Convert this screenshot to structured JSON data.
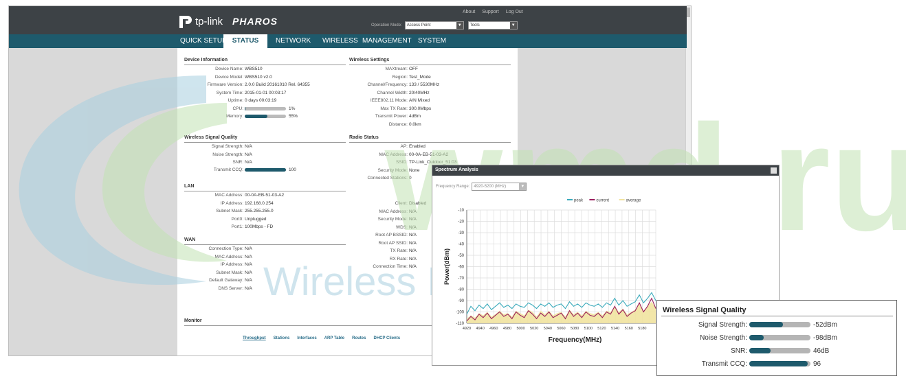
{
  "header": {
    "brand": "tp-link",
    "product": "PHAROS",
    "links": [
      "About",
      "Support",
      "Log Out"
    ],
    "operation_mode_label": "Operation Mode:",
    "operation_mode_value": "Access Point",
    "tools_value": "Tools"
  },
  "nav": {
    "items": [
      {
        "label": "QUICK SETUP",
        "active": false
      },
      {
        "label": "STATUS",
        "active": true
      },
      {
        "label": "NETWORK",
        "active": false
      },
      {
        "label": "WIRELESS",
        "active": false
      },
      {
        "label": "MANAGEMENT",
        "active": false
      },
      {
        "label": "SYSTEM",
        "active": false
      }
    ]
  },
  "device_info": {
    "title": "Device Information",
    "rows": [
      {
        "label": "Device Name:",
        "value": "WBS510"
      },
      {
        "label": "Device Model:",
        "value": "WBS510 v2.0"
      },
      {
        "label": "Firmware Version:",
        "value": "2.0.0 Build 20161010 Rel. 64355"
      },
      {
        "label": "System Time:",
        "value": "2015-01-01 00:03:17"
      },
      {
        "label": "Uptime:",
        "value": "0 days 00:03:19"
      }
    ],
    "cpu": {
      "label": "CPU:",
      "value": "1%",
      "fraction": 0.01
    },
    "memory": {
      "label": "Memory:",
      "value": "55%",
      "fraction": 0.55
    }
  },
  "wireless_settings": {
    "title": "Wireless Settings",
    "rows": [
      {
        "label": "MAXtream:",
        "value": "OFF"
      },
      {
        "label": "Region:",
        "value": "Test_Mode"
      },
      {
        "label": "Channel/Frequency:",
        "value": "133 / 5530MHz"
      },
      {
        "label": "Channel Width:",
        "value": "20/40MHz"
      },
      {
        "label": "IEEE802.11 Mode:",
        "value": "A/N Mixed"
      },
      {
        "label": "Max TX Rate:",
        "value": "300.0Mbps"
      },
      {
        "label": "Transmit Power:",
        "value": "4dBm"
      },
      {
        "label": "Distance:",
        "value": "0.0km"
      }
    ]
  },
  "wireless_signal": {
    "title": "Wireless Signal Quality",
    "rows": [
      {
        "label": "Signal Strength:",
        "value": "N/A"
      },
      {
        "label": "Noise Strength:",
        "value": "N/A"
      },
      {
        "label": "SNR:",
        "value": "N/A"
      }
    ],
    "ccq": {
      "label": "Transmit CCQ:",
      "value": "100",
      "fraction": 1.0
    }
  },
  "radio_status": {
    "title": "Radio Status",
    "rows": [
      {
        "label": "AP:",
        "value": "Enabled"
      },
      {
        "label": "MAC Address:",
        "value": "00-0A-EB-51-03-A2"
      },
      {
        "label": "SSID:",
        "value": "TP-Link_Outdoor_51:03"
      },
      {
        "label": "Security Mode:",
        "value": "None"
      },
      {
        "label": "Connected Stations:",
        "value": "0"
      }
    ]
  },
  "lan": {
    "title": "LAN",
    "rows": [
      {
        "label": "MAC Address:",
        "value": "00-0A-EB-51-03-A2"
      },
      {
        "label": "IP Address:",
        "value": "192.168.0.254"
      },
      {
        "label": "Subnet Mask:",
        "value": "255.255.255.0"
      },
      {
        "label": "Port0:",
        "value": "Unplugged"
      },
      {
        "label": "Port1:",
        "value": "100Mbps - FD"
      }
    ]
  },
  "client": {
    "rows": [
      {
        "label": "Client:",
        "value": "Disabled"
      },
      {
        "label": "MAC Address:",
        "value": "N/A"
      },
      {
        "label": "Security Mode:",
        "value": "N/A"
      },
      {
        "label": "WDS:",
        "value": "N/A"
      },
      {
        "label": "Root AP BSSID:",
        "value": "N/A"
      },
      {
        "label": "Root AP SSID:",
        "value": "N/A"
      },
      {
        "label": "TX Rate:",
        "value": "N/A"
      },
      {
        "label": "RX Rate:",
        "value": "N/A"
      },
      {
        "label": "Connection Time:",
        "value": "N/A"
      }
    ]
  },
  "wan": {
    "title": "WAN",
    "rows": [
      {
        "label": "Connection Type:",
        "value": "N/A"
      },
      {
        "label": "MAC Address:",
        "value": "N/A"
      },
      {
        "label": "IP Address:",
        "value": "N/A"
      },
      {
        "label": "Subnet Mask:",
        "value": "N/A"
      },
      {
        "label": "Default Gateway:",
        "value": "N/A"
      },
      {
        "label": "DNS Server:",
        "value": "N/A"
      }
    ]
  },
  "monitor": {
    "title": "Monitor",
    "tabs": [
      "Throughput",
      "Stations",
      "Interfaces",
      "ARP Table",
      "Routes",
      "DHCP Clients"
    ]
  },
  "watermark": {
    "big": "wmd.ru",
    "small": "Wireless Mobile Devices"
  },
  "spectrum": {
    "title": "Spectrum Analysis",
    "range_label": "Frequency Range:",
    "range_value": "4920-5200 (MHz)",
    "legend": [
      {
        "label": "peak",
        "color": "#3aaabb"
      },
      {
        "label": "current",
        "color": "#9b1f5f"
      },
      {
        "label": "average",
        "color": "#f1e3a0"
      }
    ]
  },
  "chart_data": {
    "type": "area",
    "xlabel": "Frequency(MHz)",
    "ylabel": "Power(dBm)",
    "ylim": [
      -110,
      -10
    ],
    "xlim": [
      4920,
      5200
    ],
    "y_ticks": [
      -10,
      -20,
      -30,
      -40,
      -50,
      -60,
      -70,
      -80,
      -90,
      -100,
      -110
    ],
    "x_ticks": [
      4920,
      4940,
      4960,
      4980,
      5000,
      5020,
      5040,
      5060,
      5080,
      5100,
      5120,
      5140,
      5160,
      5180
    ],
    "grid": true,
    "legend_position": "top-right",
    "series": [
      {
        "name": "peak",
        "values": [
          -102,
          -95,
          -99,
          -94,
          -97,
          -93,
          -98,
          -95,
          -92,
          -96,
          -94,
          -97,
          -93,
          -95,
          -96,
          -92,
          -94,
          -97,
          -93,
          -95,
          -92,
          -96,
          -94,
          -93,
          -97,
          -91,
          -95,
          -93,
          -96,
          -92,
          -94,
          -95,
          -93,
          -96,
          -92,
          -94,
          -88,
          -94,
          -90,
          -95,
          -93,
          -91,
          -85,
          -92,
          -88,
          -83,
          -90
        ]
      },
      {
        "name": "current",
        "values": [
          -108,
          -104,
          -107,
          -102,
          -105,
          -101,
          -106,
          -103,
          -100,
          -104,
          -102,
          -106,
          -100,
          -103,
          -105,
          -99,
          -102,
          -106,
          -101,
          -104,
          -100,
          -105,
          -103,
          -101,
          -106,
          -99,
          -104,
          -101,
          -105,
          -100,
          -103,
          -104,
          -101,
          -105,
          -100,
          -102,
          -95,
          -102,
          -98,
          -104,
          -101,
          -99,
          -92,
          -100,
          -95,
          -88,
          -97
        ]
      },
      {
        "name": "average",
        "values": [
          -106,
          -103,
          -105,
          -101,
          -103,
          -100,
          -104,
          -102,
          -99,
          -102,
          -101,
          -104,
          -99,
          -101,
          -103,
          -98,
          -100,
          -104,
          -99,
          -102,
          -99,
          -103,
          -101,
          -100,
          -104,
          -98,
          -102,
          -100,
          -103,
          -99,
          -101,
          -102,
          -100,
          -103,
          -99,
          -100,
          -95,
          -100,
          -97,
          -102,
          -100,
          -98,
          -93,
          -99,
          -95,
          -91,
          -96
        ]
      }
    ]
  },
  "signal_panel": {
    "title": "Wireless Signal Quality",
    "rows": [
      {
        "label": "Signal Strength:",
        "value": "-52dBm",
        "fraction": 0.55
      },
      {
        "label": "Noise Strength:",
        "value": "-98dBm",
        "fraction": 0.24
      },
      {
        "label": "SNR:",
        "value": "46dB",
        "fraction": 0.35
      },
      {
        "label": "Transmit CCQ:",
        "value": "96",
        "fraction": 0.96
      }
    ]
  },
  "colors": {
    "header_bg": "#3d4246",
    "nav_bg": "#1e5a6c",
    "bar_fill": "#1e5a6c",
    "watermark_green": "#c3e3b3",
    "watermark_blue": "#a8cfe0"
  }
}
